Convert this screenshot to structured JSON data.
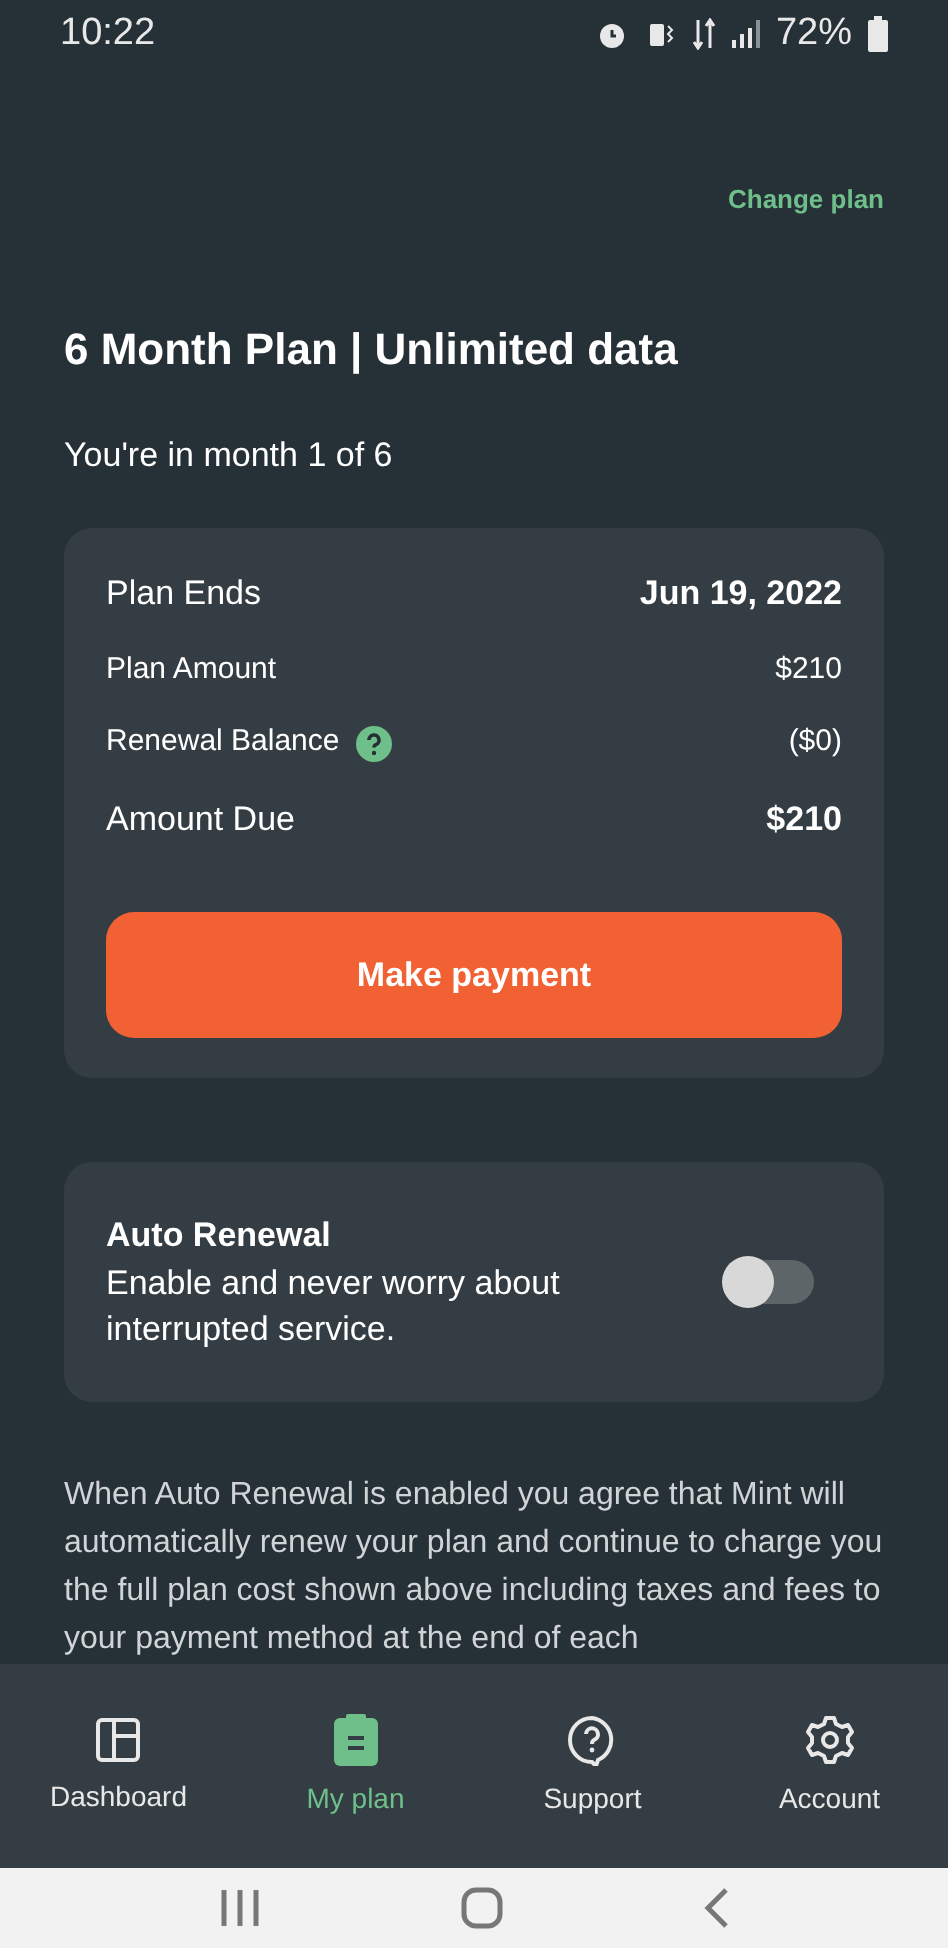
{
  "status_bar": {
    "time": "10:22",
    "battery": "72%"
  },
  "header": {
    "action": "Change plan"
  },
  "plan": {
    "title": "6 Month Plan | Unlimited data",
    "subtitle": "You're in month 1 of 6"
  },
  "summary": {
    "rows": [
      {
        "label": "Plan Ends",
        "value": "Jun 19, 2022",
        "emphasis": true,
        "help": false
      },
      {
        "label": "Plan Amount",
        "value": "$210",
        "emphasis": false,
        "help": false
      },
      {
        "label": "Renewal Balance",
        "value": "($0)",
        "emphasis": false,
        "help": true
      },
      {
        "label": "Amount Due",
        "value": "$210",
        "emphasis": true,
        "help": false
      }
    ],
    "button": "Make payment"
  },
  "auto_renewal": {
    "title": "Auto Renewal",
    "description": "Enable and never worry about interrupted service.",
    "on": false
  },
  "disclaimer": "When Auto Renewal is enabled you agree that Mint will automatically renew your plan and continue to charge you the full plan cost shown above including taxes and fees to your payment method at the end of each",
  "tabs": [
    {
      "label": "Dashboard",
      "selected": false,
      "kind": "dashboard"
    },
    {
      "label": "My plan",
      "selected": true,
      "kind": "plan"
    },
    {
      "label": "Support",
      "selected": false,
      "kind": "support"
    },
    {
      "label": "Account",
      "selected": false,
      "kind": "account"
    }
  ]
}
